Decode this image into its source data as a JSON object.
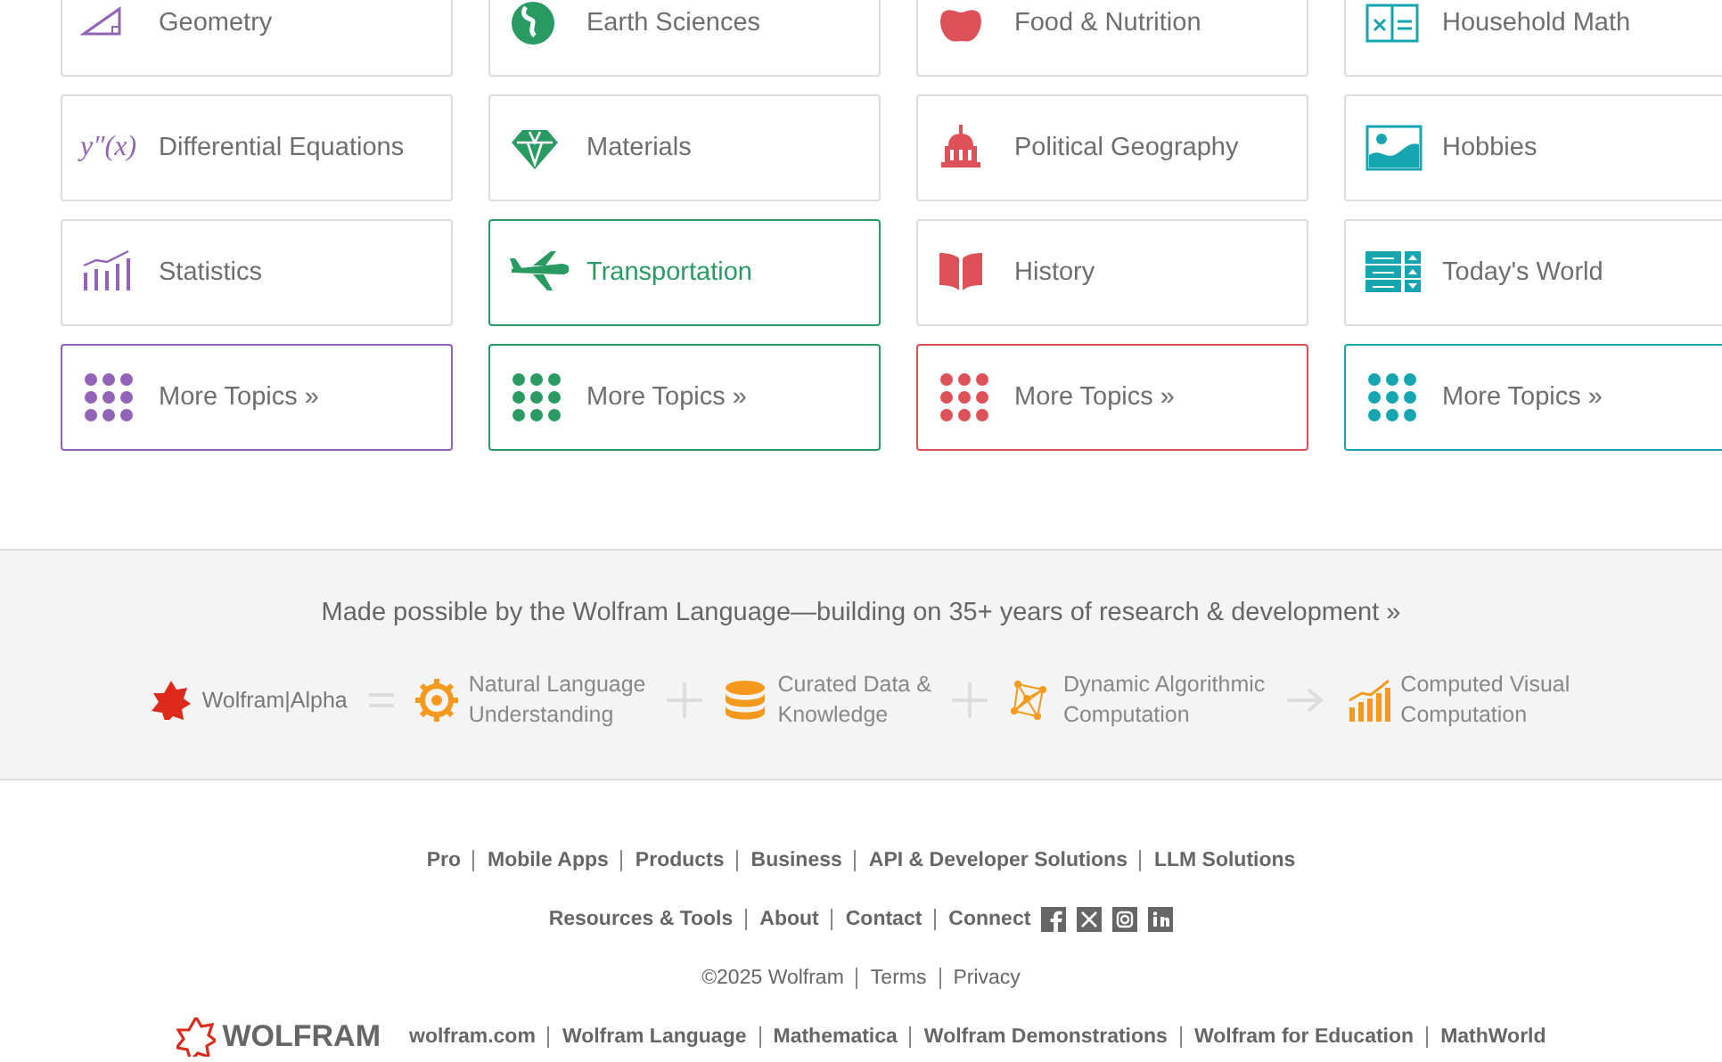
{
  "topics": [
    {
      "color": "#9363b5",
      "items": [
        {
          "label": "Geometry",
          "selected": false
        },
        {
          "label": "Differential Equations",
          "selected": false,
          "symbol": "y″(x)"
        },
        {
          "label": "Statistics",
          "selected": false
        }
      ],
      "more": "More Topics »"
    },
    {
      "color": "#2a9a63",
      "items": [
        {
          "label": "Earth Sciences",
          "selected": false
        },
        {
          "label": "Materials",
          "selected": false
        },
        {
          "label": "Transportation",
          "selected": true
        }
      ],
      "more": "More Topics »"
    },
    {
      "color": "#dd5158",
      "items": [
        {
          "label": "Food & Nutrition",
          "selected": false
        },
        {
          "label": "Political Geography",
          "selected": false
        },
        {
          "label": "History",
          "selected": false
        }
      ],
      "more": "More Topics »"
    },
    {
      "color": "#17a6b0",
      "items": [
        {
          "label": "Household Math",
          "selected": false
        },
        {
          "label": "Hobbies",
          "selected": false
        },
        {
          "label": "Today's World",
          "selected": false
        }
      ],
      "more": "More Topics »"
    }
  ],
  "banner": {
    "headline": "Made possible by the Wolfram Language—building on 35+ years of research & development »",
    "pipeline": [
      {
        "kind": "brand",
        "label": "Wolfram|Alpha"
      },
      {
        "kind": "equals"
      },
      {
        "kind": "step",
        "label": "Natural Language\nUnderstanding"
      },
      {
        "kind": "plus"
      },
      {
        "kind": "step",
        "label": "Curated Data &\nKnowledge"
      },
      {
        "kind": "plus"
      },
      {
        "kind": "step",
        "label": "Dynamic Algorithmic\nComputation"
      },
      {
        "kind": "arrow"
      },
      {
        "kind": "step",
        "label": "Computed Visual\nComputation"
      }
    ]
  },
  "footer": {
    "rows": [
      {
        "links": [
          "Pro",
          "Mobile Apps",
          "Products",
          "Business",
          "API & Developer Solutions",
          "LLM Solutions"
        ]
      },
      {
        "links": [
          "Resources & Tools",
          "About",
          "Contact",
          "Connect"
        ],
        "social": [
          {
            "kind": "facebook"
          },
          {
            "kind": "x"
          },
          {
            "kind": "instagram"
          },
          {
            "kind": "linkedin"
          }
        ]
      },
      {
        "copyright": "©2025 Wolfram",
        "links": [
          "Terms",
          "Privacy"
        ]
      },
      {
        "logo": "WOLFRAM",
        "links": [
          "wolfram.com",
          "Wolfram Language",
          "Mathematica",
          "Wolfram Demonstrations",
          "Wolfram for Education",
          "MathWorld"
        ]
      }
    ]
  }
}
